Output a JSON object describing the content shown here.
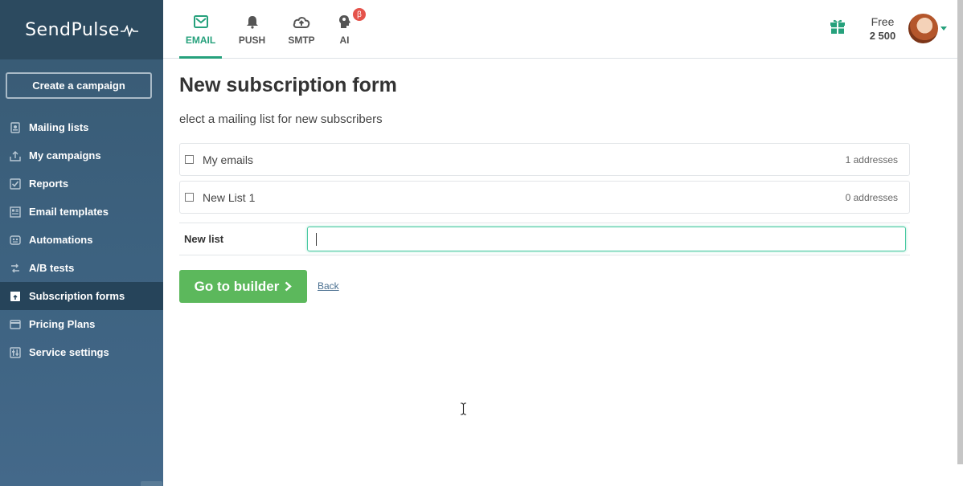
{
  "brand": {
    "logo_text": "SendPulse"
  },
  "sidebar": {
    "create_button": "Create a campaign",
    "items": [
      {
        "label": "Mailing lists",
        "icon": "address-book-icon",
        "active": false
      },
      {
        "label": "My campaigns",
        "icon": "inbox-upload-icon",
        "active": false
      },
      {
        "label": "Reports",
        "icon": "checkbox-chart-icon",
        "active": false
      },
      {
        "label": "Email templates",
        "icon": "template-icon",
        "active": false
      },
      {
        "label": "Automations",
        "icon": "automation-icon",
        "active": false
      },
      {
        "label": "A/B tests",
        "icon": "ab-test-icon",
        "active": false
      },
      {
        "label": "Subscription forms",
        "icon": "form-icon",
        "active": true
      },
      {
        "label": "Pricing Plans",
        "icon": "wallet-icon",
        "active": false
      },
      {
        "label": "Service settings",
        "icon": "sliders-icon",
        "active": false
      }
    ]
  },
  "topbar": {
    "tabs": [
      {
        "label": "EMAIL",
        "icon": "envelope-icon",
        "active": true
      },
      {
        "label": "PUSH",
        "icon": "bell-icon",
        "active": false
      },
      {
        "label": "SMTP",
        "icon": "cloud-upload-icon",
        "active": false
      },
      {
        "label": "AI",
        "icon": "brain-head-icon",
        "active": false,
        "badge": "β"
      }
    ],
    "plan": {
      "name": "Free",
      "count": "2 500"
    },
    "accent_color": "#26a17c"
  },
  "main": {
    "title": "New subscription form",
    "subtitle": "elect a mailing list for new subscribers",
    "lists": [
      {
        "name": "My emails",
        "count": "1 addresses"
      },
      {
        "name": "New List 1",
        "count": "0 addresses"
      }
    ],
    "new_list": {
      "label": "New list",
      "value": ""
    },
    "go_button": "Go to builder",
    "back_link": "Back"
  }
}
